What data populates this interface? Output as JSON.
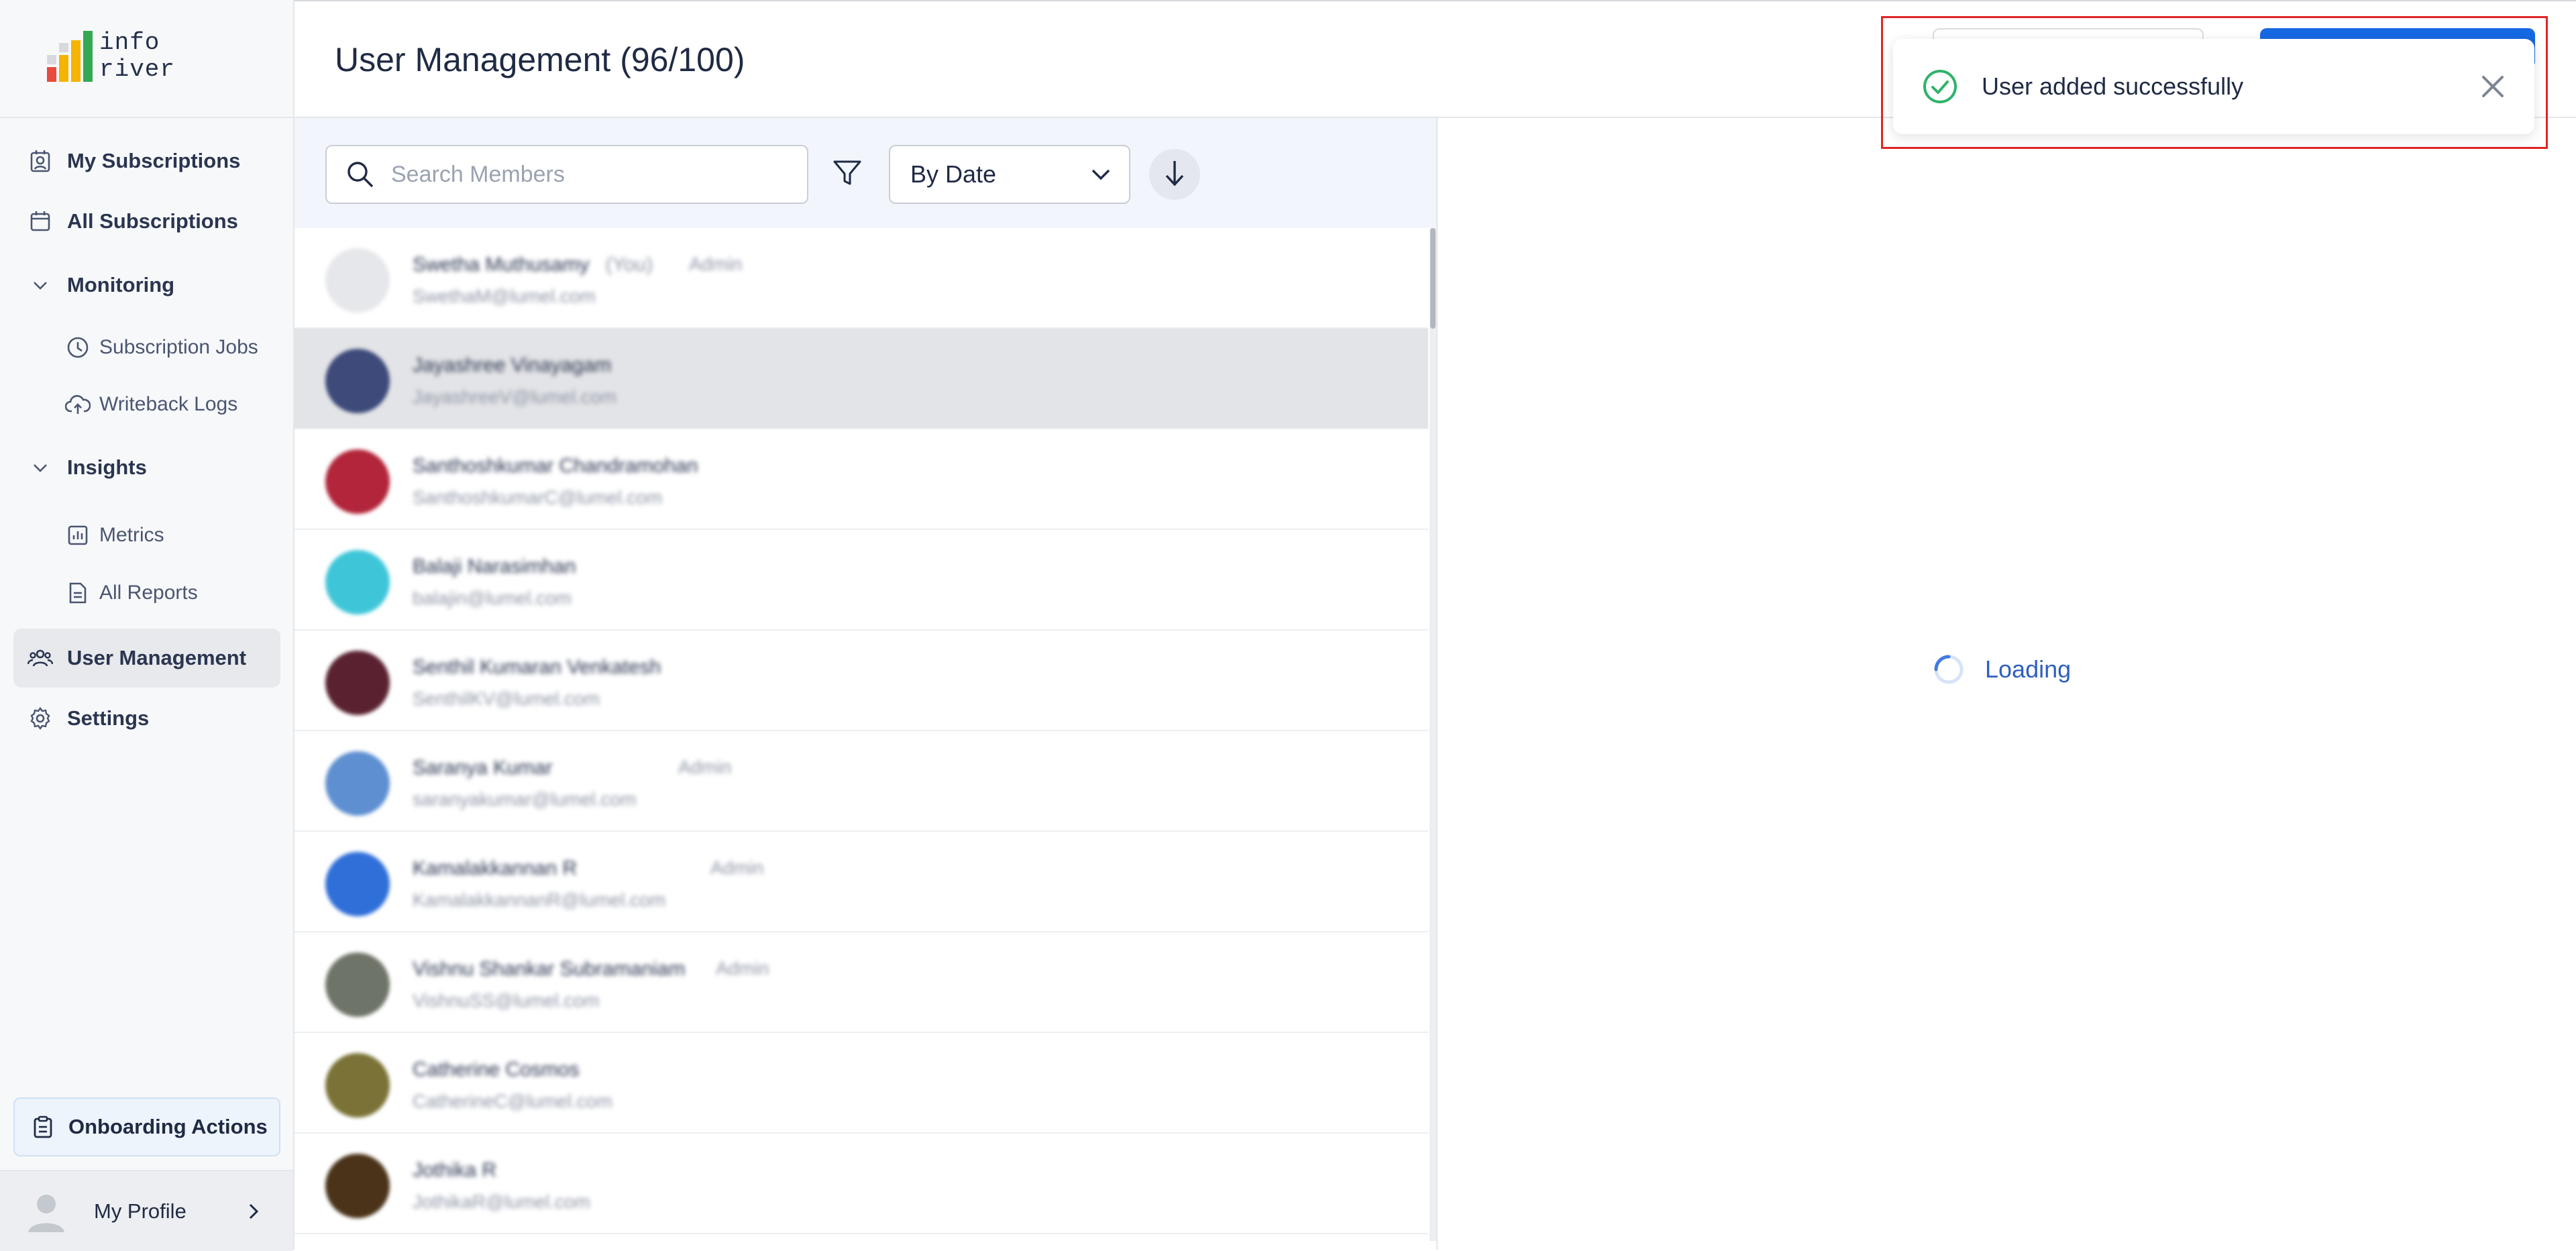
{
  "app": {
    "logo_text_line1": "info",
    "logo_text_line2": "river",
    "logo_colors": [
      "#e94b3c",
      "#f5b400",
      "#34a853",
      "#d6d9de"
    ]
  },
  "sidebar": {
    "items": [
      {
        "label": "My Subscriptions",
        "icon": "subscription-user-icon"
      },
      {
        "label": "All Subscriptions",
        "icon": "calendar-icon"
      },
      {
        "label": "Monitoring",
        "icon": "chevron-down-icon"
      },
      {
        "label": "Subscription Jobs",
        "icon": "clock-icon"
      },
      {
        "label": "Writeback Logs",
        "icon": "cloud-upload-icon"
      },
      {
        "label": "Insights",
        "icon": "chevron-down-icon"
      },
      {
        "label": "Metrics",
        "icon": "bar-chart-icon"
      },
      {
        "label": "All Reports",
        "icon": "document-icon"
      },
      {
        "label": "User Management",
        "icon": "users-icon"
      },
      {
        "label": "Settings",
        "icon": "gear-icon"
      }
    ],
    "onboarding_label": "Onboarding Actions",
    "profile_label": "My Profile"
  },
  "header": {
    "title": "User Management (96/100)"
  },
  "toolbar": {
    "search_placeholder": "Search Members",
    "sort_value": "By Date"
  },
  "members": [
    {
      "name": "Swetha Muthusamy",
      "you": "(You)",
      "role": "Admin",
      "email": "SwethaM@lumel.com",
      "avatar_color": "#e6e7ea"
    },
    {
      "name": "Jayashree Vinayagam",
      "you": "",
      "role": "",
      "email": "JayashreeV@lumel.com",
      "avatar_color": "#3d4a7a"
    },
    {
      "name": "Santhoshkumar Chandramohan",
      "you": "",
      "role": "",
      "email": "SanthoshkumarC@lumel.com",
      "avatar_color": "#b2253a"
    },
    {
      "name": "Balaji Narasimhan",
      "you": "",
      "role": "",
      "email": "balajin@lumel.com",
      "avatar_color": "#3ec6d8"
    },
    {
      "name": "Senthil Kumaran Venkatesh",
      "you": "",
      "role": "",
      "email": "SenthilKV@lumel.com",
      "avatar_color": "#5a2230"
    },
    {
      "name": "Saranya Kumar",
      "you": "",
      "role": "Admin",
      "email": "saranyakumar@lumel.com",
      "avatar_color": "#5e8fd1"
    },
    {
      "name": "Kamalakkannan R",
      "you": "",
      "role": "Admin",
      "email": "KamalakkannanR@lumel.com",
      "avatar_color": "#2f6fd8"
    },
    {
      "name": "Vishnu Shankar Subramaniam",
      "you": "",
      "role": "Admin",
      "email": "VishnuSS@lumel.com",
      "avatar_color": "#6f7468"
    },
    {
      "name": "Catherine Cosmos",
      "you": "",
      "role": "",
      "email": "CatherineC@lumel.com",
      "avatar_color": "#7a7236"
    },
    {
      "name": "Jothika R",
      "you": "",
      "role": "",
      "email": "JothikaR@lumel.com",
      "avatar_color": "#4a3318"
    }
  ],
  "detail": {
    "loading_text": "Loading"
  },
  "toast": {
    "message": "User added successfully",
    "status_color": "#2fb36a"
  },
  "colors": {
    "primary": "#1668e3",
    "text": "#1f2a44",
    "highlight_border": "#e02424"
  }
}
